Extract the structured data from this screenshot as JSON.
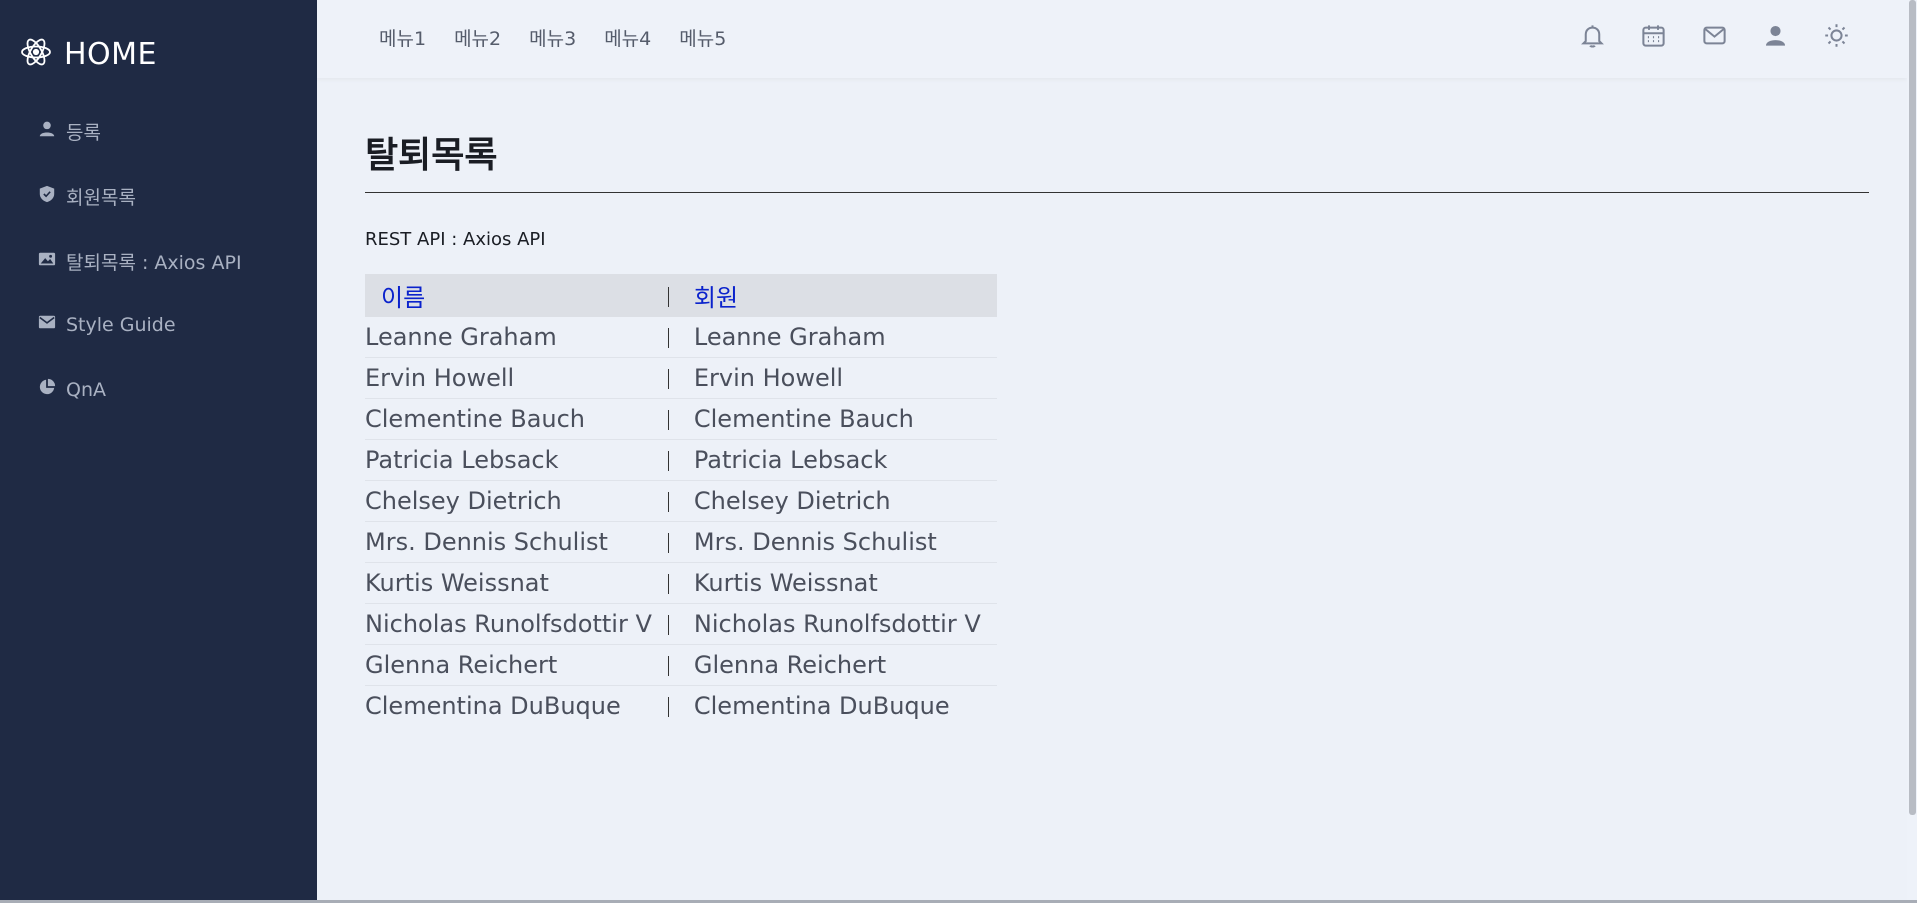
{
  "sidebar": {
    "brand": "HOME",
    "brand_icon": "atom-icon",
    "items": [
      {
        "label": "등록",
        "icon": "user-icon"
      },
      {
        "label": "회원목록",
        "icon": "shield-icon"
      },
      {
        "label": "탈퇴목록 : Axios API",
        "icon": "image-icon"
      },
      {
        "label": "Style Guide",
        "icon": "mail-icon"
      },
      {
        "label": "QnA",
        "icon": "pie-chart-icon"
      }
    ]
  },
  "topbar": {
    "menus": [
      "메뉴1",
      "메뉴2",
      "메뉴3",
      "메뉴4",
      "메뉴5"
    ],
    "icons": [
      "bell-icon",
      "calendar-icon",
      "mail-icon",
      "user-icon",
      "sun-icon"
    ]
  },
  "main": {
    "title": "탈퇴목록",
    "api_label": "REST API : Axios API",
    "table": {
      "headers": [
        "이름",
        "회원"
      ],
      "rows": [
        [
          "Leanne Graham",
          "Leanne Graham"
        ],
        [
          "Ervin Howell",
          "Ervin Howell"
        ],
        [
          "Clementine Bauch",
          "Clementine Bauch"
        ],
        [
          "Patricia Lebsack",
          "Patricia Lebsack"
        ],
        [
          "Chelsey Dietrich",
          "Chelsey Dietrich"
        ],
        [
          "Mrs. Dennis Schulist",
          "Mrs. Dennis Schulist"
        ],
        [
          "Kurtis Weissnat",
          "Kurtis Weissnat"
        ],
        [
          "Nicholas Runolfsdottir V",
          "Nicholas Runolfsdottir V"
        ],
        [
          "Glenna Reichert",
          "Glenna Reichert"
        ],
        [
          "Clementina DuBuque",
          "Clementina DuBuque"
        ]
      ]
    }
  },
  "colors": {
    "sidebar_bg": "#1f2a44",
    "content_bg": "#edf1f8",
    "header_link": "#0a22cc"
  }
}
